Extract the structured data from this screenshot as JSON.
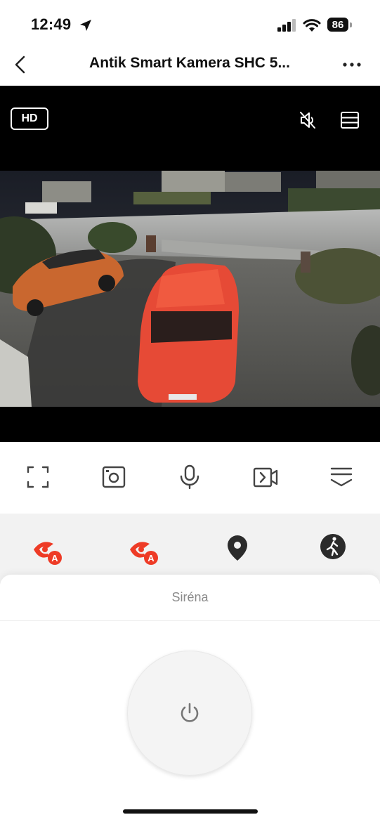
{
  "status_bar": {
    "time": "12:49",
    "battery": "86"
  },
  "nav": {
    "title": "Antik Smart Kamera SHC 5..."
  },
  "video": {
    "quality_badge": "HD"
  },
  "siren": {
    "title": "Siréna"
  },
  "colors": {
    "accent": "#ee3b26",
    "icon": "#333333"
  }
}
